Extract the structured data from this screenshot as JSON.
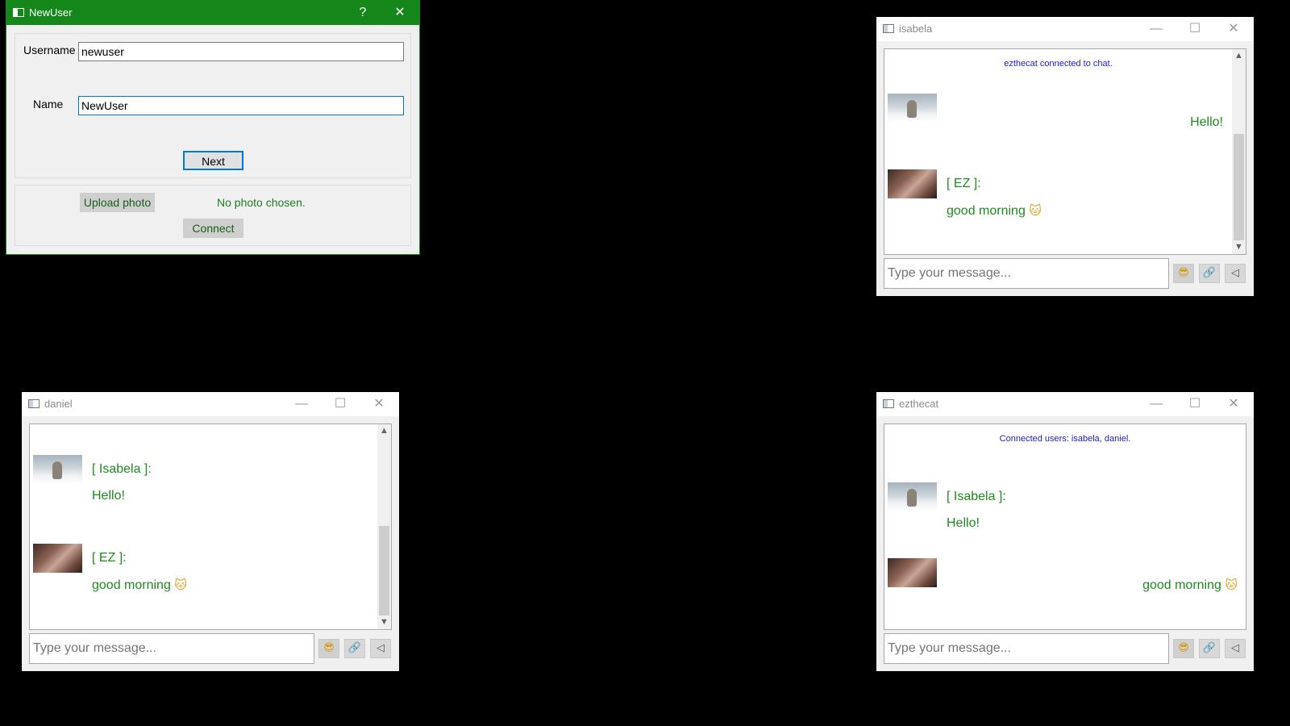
{
  "dialog": {
    "title": "NewUser",
    "help": "?",
    "close": "✕",
    "username_label": "Username",
    "username_value": "newuser",
    "name_label": "Name",
    "name_value": "NewUser",
    "next_label": "Next",
    "upload_label": "Upload photo",
    "photo_status": "No photo chosen.",
    "connect_label": "Connect"
  },
  "window_controls": {
    "minimize": "—",
    "maximize": "☐",
    "close": "✕"
  },
  "isabela": {
    "title": "isabela",
    "system_message": "ezthecat connected to chat.",
    "own_message": "Hello!",
    "other_sender": "[ EZ ]:",
    "other_message": "good morning",
    "emoji": "🐱",
    "input_placeholder": "Type your message..."
  },
  "daniel": {
    "title": "daniel",
    "msg1_sender": "[ Isabela ]:",
    "msg1_text": "Hello!",
    "msg2_sender": "[ EZ ]:",
    "msg2_text": "good morning",
    "emoji": "🐱",
    "input_placeholder": "Type your message..."
  },
  "ezthecat": {
    "title": "ezthecat",
    "system_message": "Connected users: isabela, daniel.",
    "msg1_sender": "[ Isabela ]:",
    "msg1_text": "Hello!",
    "own_message": "good morning",
    "emoji": "🐱",
    "input_placeholder": "Type your message..."
  },
  "input_buttons": {
    "emoji": "😎",
    "attach": "🔗",
    "send": "◁"
  },
  "colors": {
    "dialog_title": "#16871b",
    "message_green": "#1f8a1f",
    "system_blue": "#1c1cc8",
    "focus_blue": "#0078d7"
  },
  "icons": {
    "app": "window-app-icon",
    "emoji": "sunglasses-emoji-icon",
    "attach": "paperclip-icon",
    "send": "send-arrow-icon"
  }
}
